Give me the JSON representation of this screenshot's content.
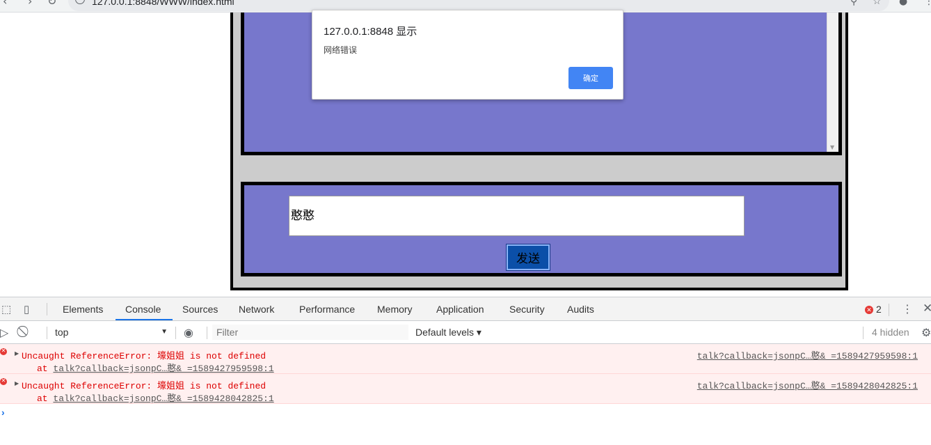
{
  "browser": {
    "url": "127.0.0.1:8848/WWW/index.html"
  },
  "dialog": {
    "title": "127.0.0.1:8848 显示",
    "message": "网络错误",
    "ok_label": "确定"
  },
  "chat": {
    "input_value": "憨憨",
    "send_label": "发送"
  },
  "devtools": {
    "tabs": [
      "Elements",
      "Console",
      "Sources",
      "Network",
      "Performance",
      "Memory",
      "Application",
      "Security",
      "Audits"
    ],
    "active_tab": "Console",
    "error_count": "2",
    "context": "top",
    "filter_placeholder": "Filter",
    "levels_label": "Default levels",
    "hidden_label": "4 hidden",
    "logs": [
      {
        "message": "Uncaught ReferenceError: 壕姐姐 is not defined",
        "at_prefix": "at ",
        "at_link": "talk?callback=jsonpC…憨&_=1589427959598:1",
        "source": "talk?callback=jsonpC…憨&_=1589427959598:1"
      },
      {
        "message": "Uncaught ReferenceError: 壕姐姐 is not defined",
        "at_prefix": "at ",
        "at_link": "talk?callback=jsonpC…憨&_=1589428042825:1",
        "source": "talk?callback=jsonpC…憨&_=1589428042825:1"
      }
    ],
    "prompt": "›"
  },
  "colors": {
    "panel": "#7777cc",
    "frame": "#cccccc",
    "dialog_button": "#4285f4",
    "error_text": "#dd0000",
    "active_tab": "#1a73e8"
  }
}
